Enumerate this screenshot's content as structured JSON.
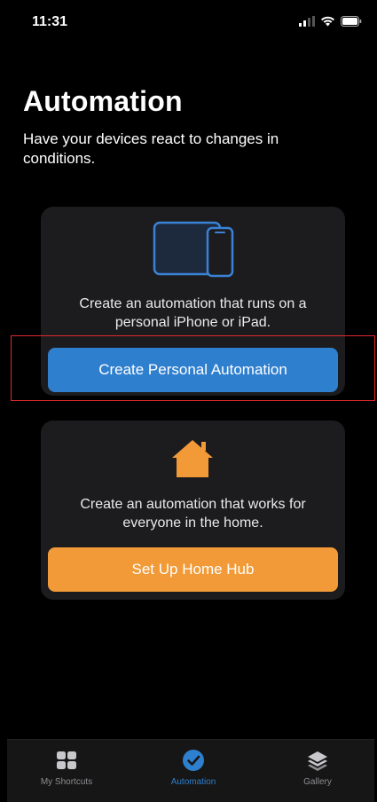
{
  "status": {
    "time": "11:31"
  },
  "header": {
    "title": "Automation",
    "subtitle": "Have your devices react to changes in conditions."
  },
  "cards": {
    "personal": {
      "icon": "iphone-ipad-icon",
      "text": "Create an automation that runs on a personal iPhone or iPad.",
      "button_label": "Create Personal Automation",
      "accent": "#2f7fcf"
    },
    "home": {
      "icon": "house-icon",
      "text": "Create an automation that works for everyone in the home.",
      "button_label": "Set Up Home Hub",
      "accent": "#f19a37"
    }
  },
  "tabbar": {
    "items": [
      {
        "label": "My Shortcuts",
        "icon": "grid-icon",
        "active": false
      },
      {
        "label": "Automation",
        "icon": "clock-check-icon",
        "active": true
      },
      {
        "label": "Gallery",
        "icon": "layers-icon",
        "active": false
      }
    ]
  },
  "highlight": {
    "color": "#e0292e"
  }
}
